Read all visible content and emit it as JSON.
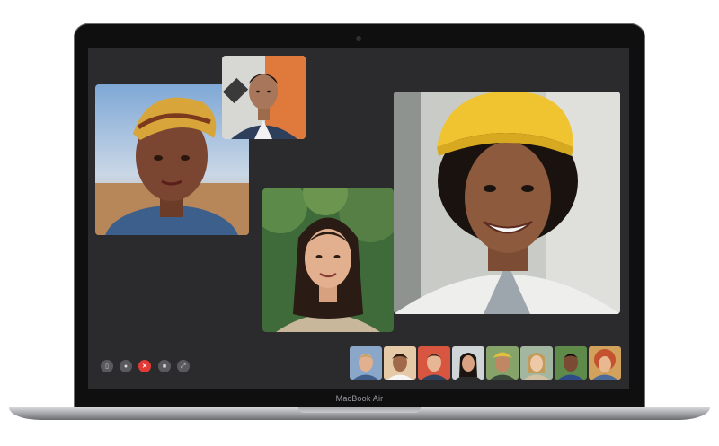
{
  "device": {
    "label": "MacBook Air"
  },
  "icons": {
    "sidebar": "sidebar-icon",
    "mute": "microphone-icon",
    "end": "end-call-icon",
    "camera": "video-camera-icon",
    "fullscreen": "fullscreen-icon"
  },
  "controls": {
    "sidebar_glyph": "▯",
    "mute_glyph": "●",
    "end_glyph": "✕",
    "camera_glyph": "■",
    "fullscreen_glyph": "⤢"
  },
  "colors": {
    "screen": "#2b2b2d",
    "end_call": "#e23b36",
    "control": "#5a5a5e"
  }
}
